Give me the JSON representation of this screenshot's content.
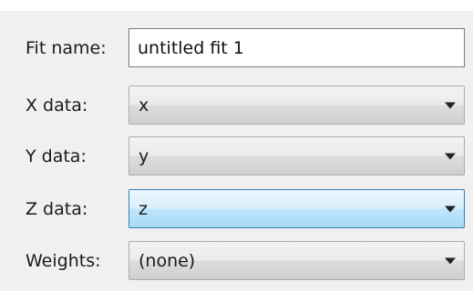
{
  "form": {
    "fit_name": {
      "label": "Fit name:",
      "value": "untitled fit 1"
    },
    "x_data": {
      "label": "X data:",
      "value": "x"
    },
    "y_data": {
      "label": "Y data:",
      "value": "y"
    },
    "z_data": {
      "label": "Z data:",
      "value": "z"
    },
    "weights": {
      "label": "Weights:",
      "value": "(none)"
    }
  },
  "icons": {
    "dropdown_arrow": "chevron-down-icon"
  },
  "colors": {
    "panel_background": "#f0f0f0",
    "combo_focused_accent": "#3c7fb1"
  }
}
